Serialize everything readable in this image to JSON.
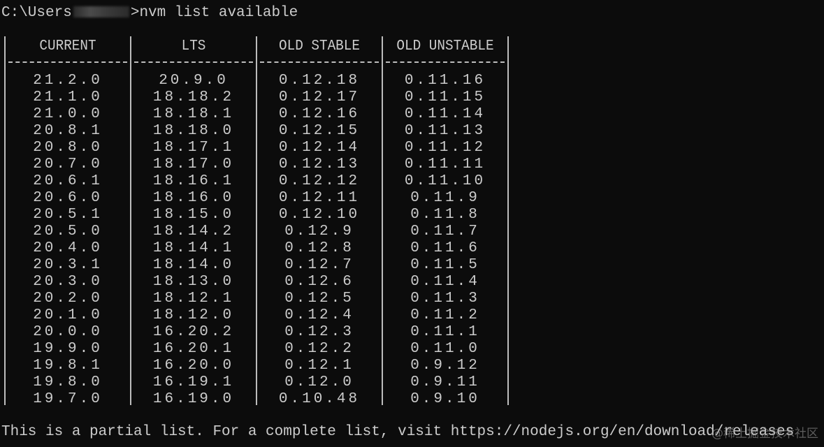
{
  "prompt": {
    "path_prefix": "C:\\Users",
    "path_suffix": ">",
    "command": "nvm list available"
  },
  "table": {
    "columns": [
      {
        "header": "CURRENT",
        "values": [
          "21.2.0",
          "21.1.0",
          "21.0.0",
          "20.8.1",
          "20.8.0",
          "20.7.0",
          "20.6.1",
          "20.6.0",
          "20.5.1",
          "20.5.0",
          "20.4.0",
          "20.3.1",
          "20.3.0",
          "20.2.0",
          "20.1.0",
          "20.0.0",
          "19.9.0",
          "19.8.1",
          "19.8.0",
          "19.7.0"
        ]
      },
      {
        "header": "LTS",
        "values": [
          "20.9.0",
          "18.18.2",
          "18.18.1",
          "18.18.0",
          "18.17.1",
          "18.17.0",
          "18.16.1",
          "18.16.0",
          "18.15.0",
          "18.14.2",
          "18.14.1",
          "18.14.0",
          "18.13.0",
          "18.12.1",
          "18.12.0",
          "16.20.2",
          "16.20.1",
          "16.20.0",
          "16.19.1",
          "16.19.0"
        ]
      },
      {
        "header": "OLD STABLE",
        "values": [
          "0.12.18",
          "0.12.17",
          "0.12.16",
          "0.12.15",
          "0.12.14",
          "0.12.13",
          "0.12.12",
          "0.12.11",
          "0.12.10",
          "0.12.9",
          "0.12.8",
          "0.12.7",
          "0.12.6",
          "0.12.5",
          "0.12.4",
          "0.12.3",
          "0.12.2",
          "0.12.1",
          "0.12.0",
          "0.10.48"
        ]
      },
      {
        "header": "OLD UNSTABLE",
        "values": [
          "0.11.16",
          "0.11.15",
          "0.11.14",
          "0.11.13",
          "0.11.12",
          "0.11.11",
          "0.11.10",
          "0.11.9",
          "0.11.8",
          "0.11.7",
          "0.11.6",
          "0.11.5",
          "0.11.4",
          "0.11.3",
          "0.11.2",
          "0.11.1",
          "0.11.0",
          "0.9.12",
          "0.9.11",
          "0.9.10"
        ]
      }
    ]
  },
  "footer": {
    "text": "This is a partial list. For a complete list, visit https://nodejs.org/en/download/releases"
  },
  "watermark": {
    "text": "@稀土掘金技术社区"
  },
  "colors": {
    "background": "#0c0c0c",
    "foreground": "#cccccc",
    "lines": "#bdbdbd"
  }
}
